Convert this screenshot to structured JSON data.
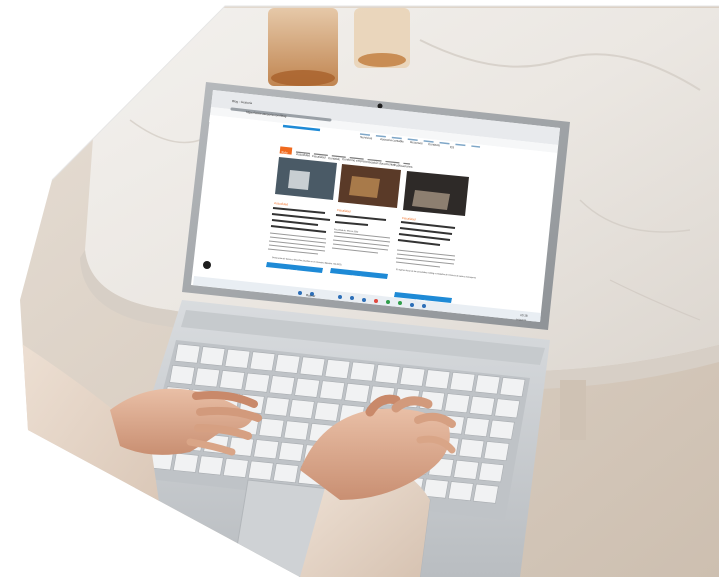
{
  "browser": {
    "tab_title": "Blog - Gestoria",
    "address": "https://www.asesoria.com/blog",
    "nav_items": [
      "Servicios",
      "Asesoria contable",
      "Recursos",
      "Contacto",
      "ES"
    ]
  },
  "site": {
    "categories": [
      "Todo",
      "Actualidad",
      "Fiscalidad",
      "Contable",
      "Conforme empresa",
      "Gestión documental",
      "Publicaciones"
    ],
    "articles": [
      {
        "tag": "Actualidad",
        "title": "Declaración de bienes y derechos situados en el extranjero (Modelo 720-2022)",
        "button": "Ver más"
      },
      {
        "tag": "Fiscalidad",
        "title": "Fiscalidad de: febrero 2023",
        "button": "Ver más"
      },
      {
        "tag": "Fiscalidad",
        "title": "El régimen fiscal de las sociedades holding o entidades de tenencia de valores extranjeros",
        "button": "Ver más"
      }
    ]
  },
  "taskbar": {
    "search_label": "Buscar",
    "time": "10:18",
    "date": "14/02/2023"
  },
  "colors": {
    "accent": "#f06a1e",
    "link_blue": "#1e8ad6",
    "laptop_silver": "#c9cccf",
    "marble": "#ebe7e2"
  }
}
